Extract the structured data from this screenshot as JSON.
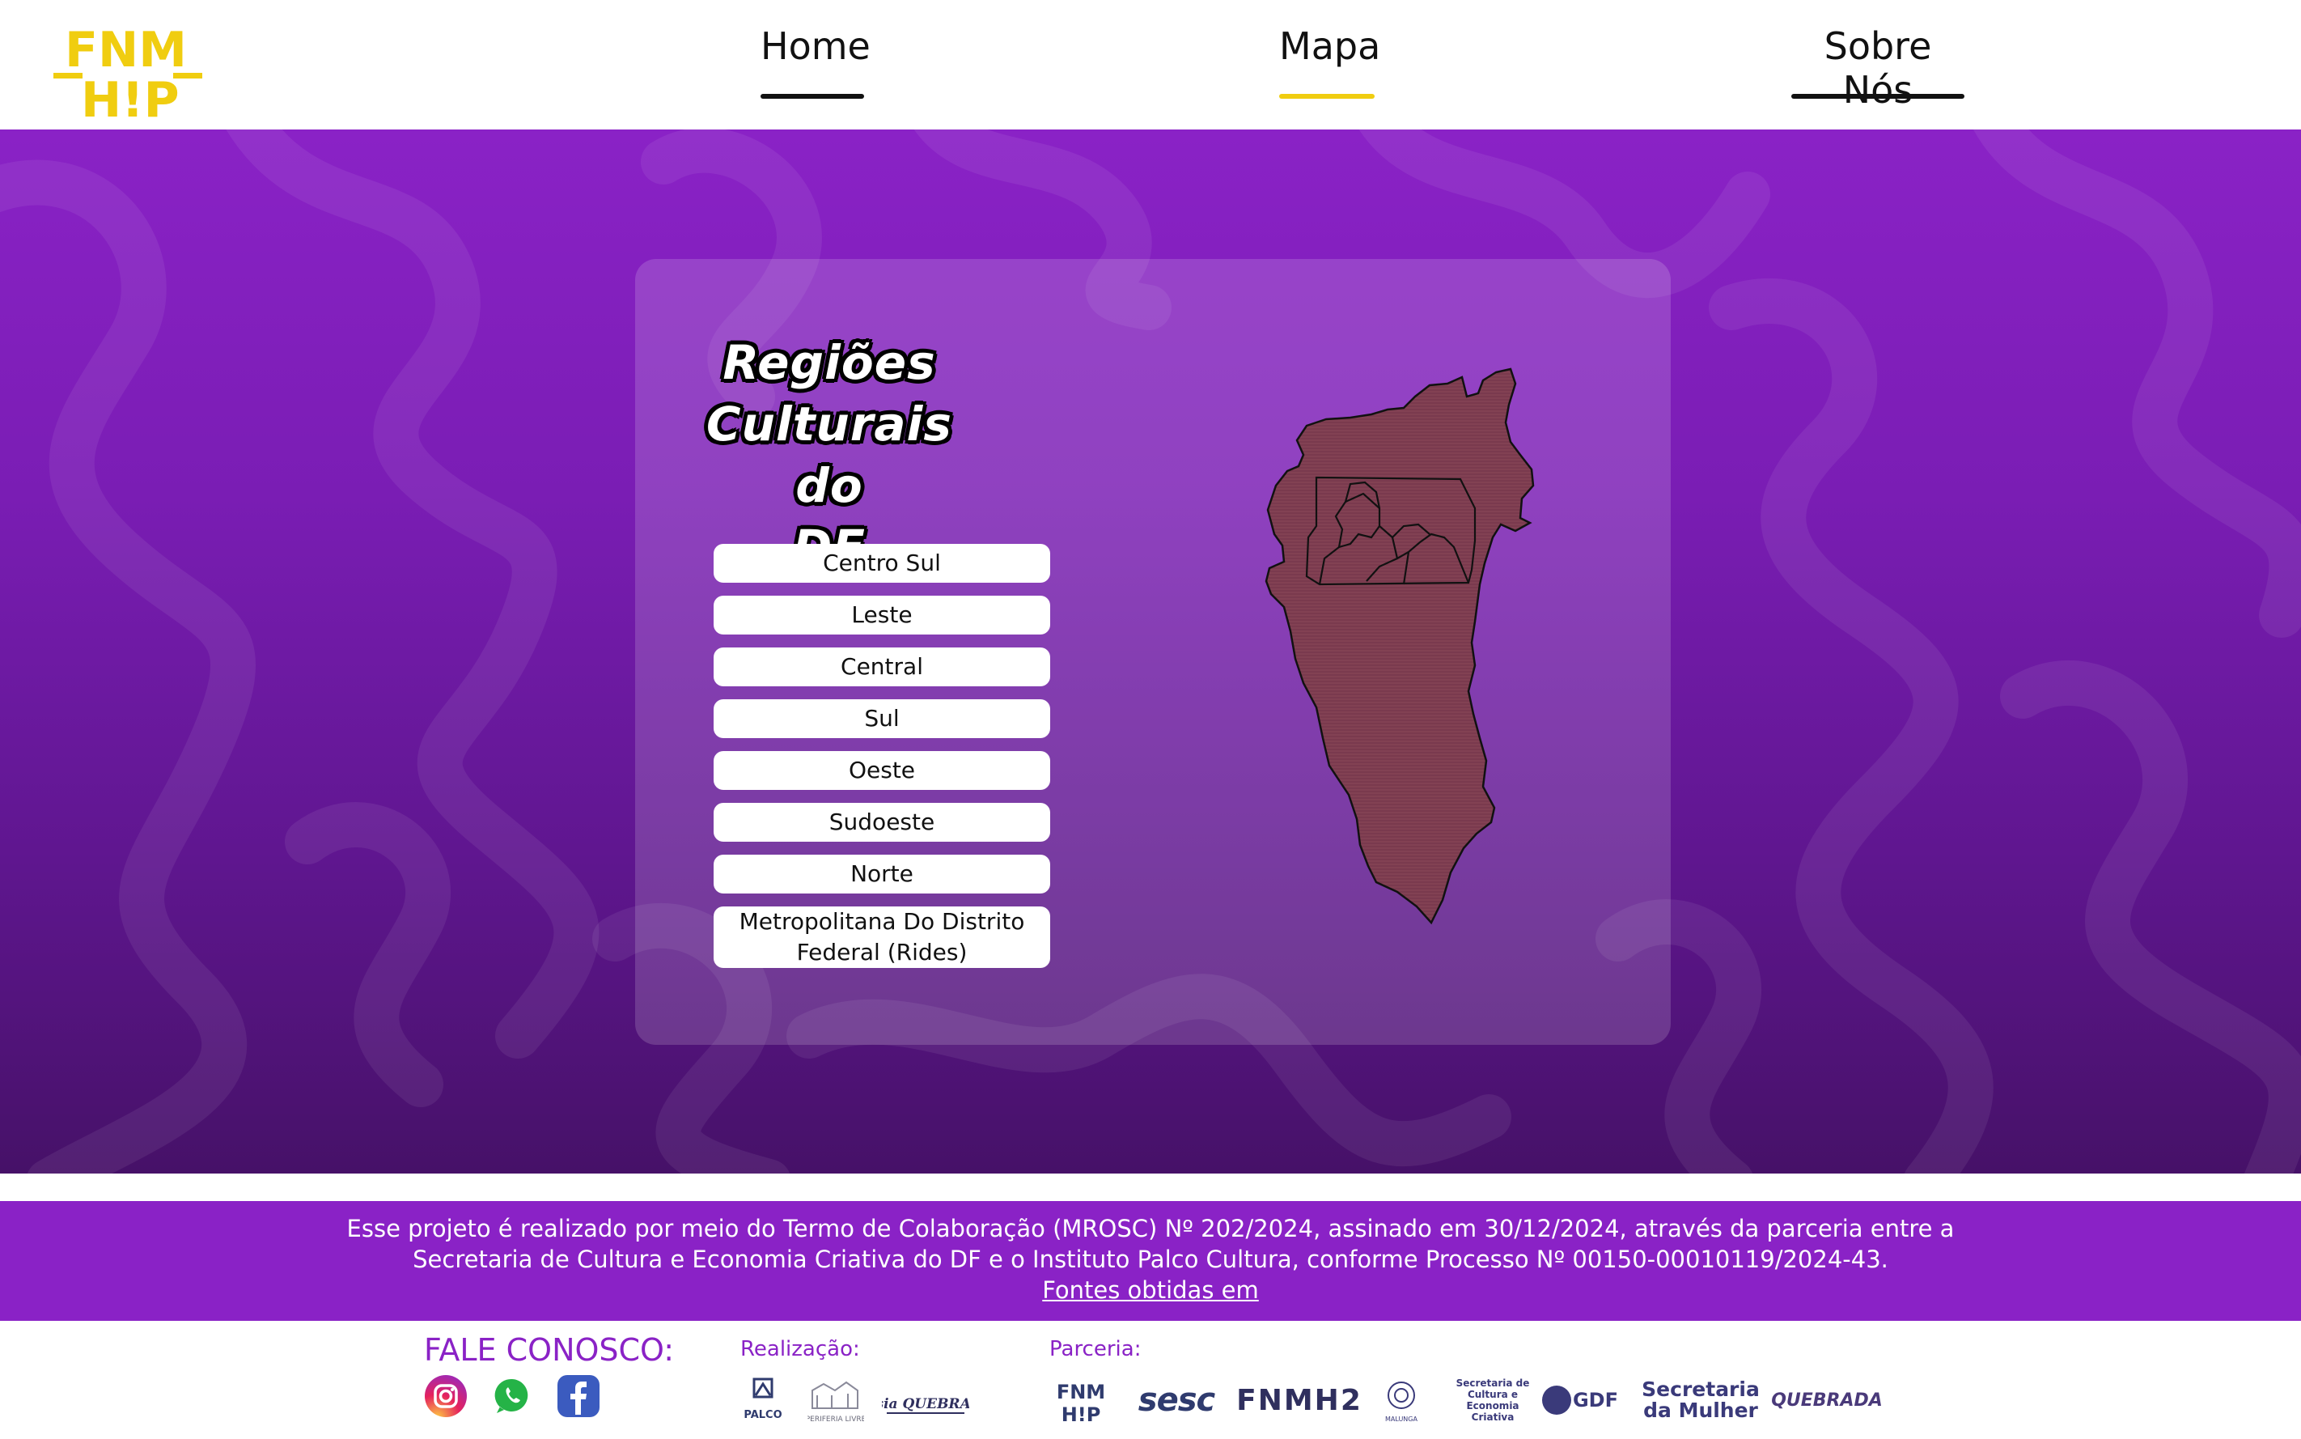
{
  "header": {
    "logo_text_top": "FNM",
    "logo_text_bottom": "H!P",
    "nav": [
      {
        "label": "Home",
        "active": false
      },
      {
        "label": "Mapa",
        "active": true
      },
      {
        "label": "Sobre Nós",
        "active": false
      }
    ]
  },
  "main": {
    "title_line1": "Regiões",
    "title_line2": "Culturais do",
    "title_line3": "DF",
    "regions": [
      "Centro Sul",
      "Leste",
      "Central",
      "Sul",
      "Oeste",
      "Sudoeste",
      "Norte",
      "Metropolitana Do Distrito Federal (Rides)"
    ]
  },
  "footer": {
    "notice_line1": "Esse projeto é realizado por meio do Termo de Colaboração (MROSC) Nº 202/2024, assinado em 30/12/2024, através da parceria entre a",
    "notice_line2": "Secretaria de Cultura e Economia Criativa do DF e o Instituto Palco Cultura, conforme Processo Nº 00150-00010119/2024-43.",
    "sources_link": "Fontes obtidas em",
    "contact_title": "FALE CONOSCO:",
    "realizacao_label": "Realização:",
    "parceria_label": "Parceria:",
    "realizacao_logos": [
      {
        "name": "palco",
        "text": "PALCO"
      },
      {
        "name": "periferia-livre",
        "text": "PERIFERIA LIVRE"
      },
      {
        "name": "poesia-quebradas",
        "text": "Poesia QUEBRADAS"
      }
    ],
    "parceria_logos": [
      {
        "name": "fnm-hip",
        "text": "FNM H!P"
      },
      {
        "name": "sesc",
        "text": "sesc"
      },
      {
        "name": "fnmh2",
        "text": "FNMH2"
      },
      {
        "name": "mandala",
        "text": "MALUNGA"
      },
      {
        "name": "secretaria-cultura",
        "text": "Secretaria de Cultura e Economia Criativa"
      },
      {
        "name": "gdf",
        "text": "GDF"
      },
      {
        "name": "secretaria-mulher",
        "text1": "Secretaria",
        "text2": "da Mulher"
      },
      {
        "name": "conexoes",
        "text": "QUEBRADA"
      }
    ]
  },
  "colors": {
    "purple": "#8a22c6",
    "yellow": "#f0cd10",
    "map_fill": "#7a3a4e"
  }
}
